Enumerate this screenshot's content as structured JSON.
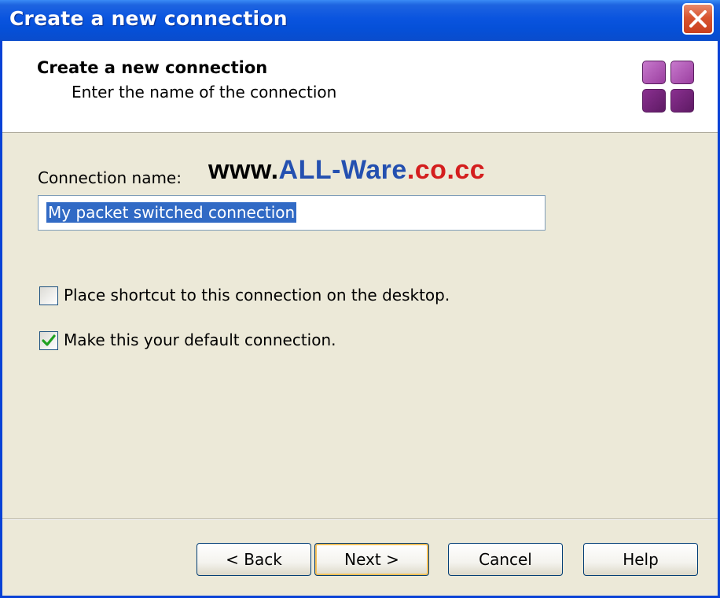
{
  "window": {
    "title": "Create a new connection"
  },
  "header": {
    "title": "Create a new connection",
    "subtitle": "Enter the name of the connection"
  },
  "form": {
    "connection_name_label": "Connection name:",
    "connection_name_value": "My packet switched connection",
    "watermark": {
      "part1": "www.",
      "part2": "ALL-Ware",
      "part3": ".co.cc"
    },
    "checkboxes": [
      {
        "label": "Place shortcut to this connection on the desktop.",
        "checked": false
      },
      {
        "label": "Make this your default connection.",
        "checked": true
      }
    ]
  },
  "buttons": {
    "back": "< Back",
    "next": "Next >",
    "cancel": "Cancel",
    "help": "Help"
  },
  "colors": {
    "titlebar": "#0a54df",
    "dialog_bg": "#ece9d8",
    "selection": "#316ac5",
    "logo_purple": "#9b3fa0",
    "logo_dark": "#6b1f6f"
  },
  "icons": {
    "close": "close-icon",
    "logo": "connection-tiles-icon",
    "check": "checkmark-icon"
  }
}
